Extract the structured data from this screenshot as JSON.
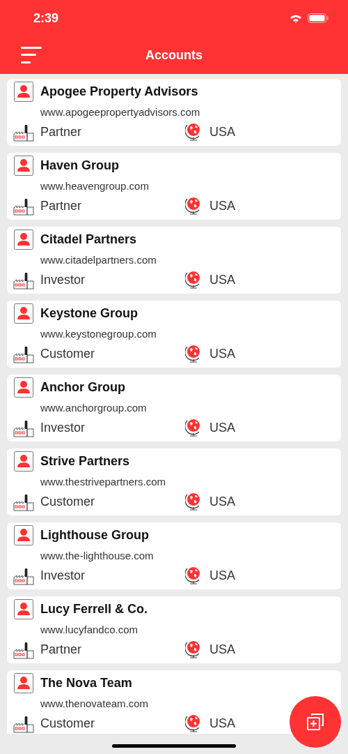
{
  "status_bar": {
    "time": "2:39"
  },
  "nav": {
    "title": "Accounts"
  },
  "accounts": [
    {
      "name": "Apogee Property Advisors",
      "url": "www.apogeepropertyadvisors.com",
      "type": "Partner",
      "country": "USA"
    },
    {
      "name": "Haven Group",
      "url": "www.heavengroup.com",
      "type": "Partner",
      "country": "USA"
    },
    {
      "name": "Citadel Partners",
      "url": "www.citadelpartners.com",
      "type": "Investor",
      "country": "USA"
    },
    {
      "name": "Keystone Group",
      "url": "www.keystonegroup.com",
      "type": "Customer",
      "country": "USA"
    },
    {
      "name": "Anchor Group",
      "url": "www.anchorgroup.com",
      "type": "Investor",
      "country": "USA"
    },
    {
      "name": "Strive Partners",
      "url": "www.thestrivepartners.com",
      "type": "Customer",
      "country": "USA"
    },
    {
      "name": "Lighthouse Group",
      "url": "www.the-lighthouse.com",
      "type": "Investor",
      "country": "USA"
    },
    {
      "name": "Lucy Ferrell & Co.",
      "url": "www.lucyfandco.com",
      "type": "Partner",
      "country": "USA"
    },
    {
      "name": "The Nova Team",
      "url": "www.thenovateam.com",
      "type": "Customer",
      "country": "USA"
    }
  ]
}
